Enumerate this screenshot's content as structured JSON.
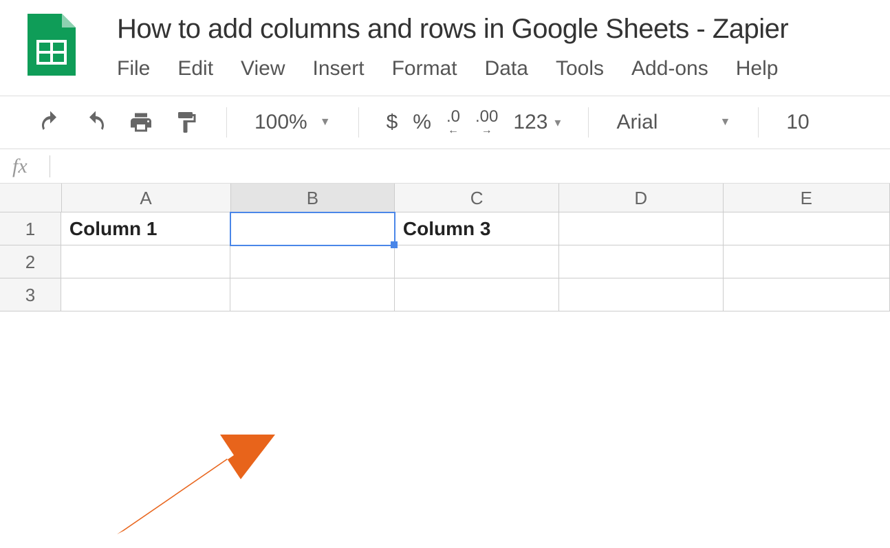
{
  "document": {
    "title": "How to add columns and rows in Google Sheets - Zapier"
  },
  "menu": {
    "file": "File",
    "edit": "Edit",
    "view": "View",
    "insert": "Insert",
    "format": "Format",
    "data": "Data",
    "tools": "Tools",
    "addons": "Add-ons",
    "help": "Help"
  },
  "toolbar": {
    "zoom": "100%",
    "currency": "$",
    "percent": "%",
    "dec_dec": ".0",
    "dec_inc": ".00",
    "num_format": "123",
    "font": "Arial",
    "font_size": "10"
  },
  "formula": {
    "fx_label": "fx",
    "value": ""
  },
  "grid": {
    "columns": [
      "A",
      "B",
      "C",
      "D",
      "E"
    ],
    "rows": [
      "1",
      "2",
      "3"
    ],
    "selected_cell": "B1",
    "selected_column": "B",
    "data": {
      "A1": "Column 1",
      "B1": "",
      "C1": "Column 3",
      "D1": "",
      "E1": "",
      "A2": "",
      "B2": "",
      "C2": "",
      "D2": "",
      "E2": "",
      "A3": "",
      "B3": "",
      "C3": "",
      "D3": "",
      "E3": ""
    }
  },
  "annotation": {
    "color": "#e8641b"
  }
}
